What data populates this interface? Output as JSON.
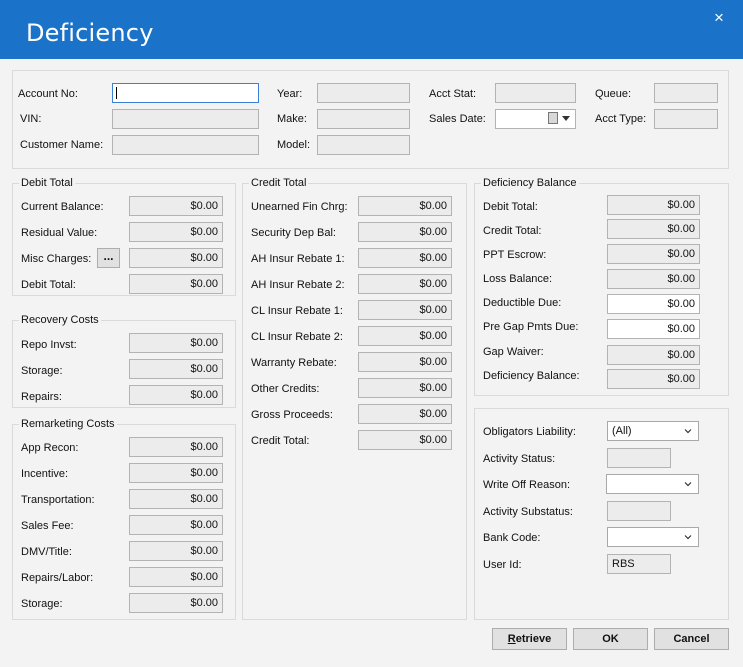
{
  "window": {
    "title": "Deficiency",
    "close_glyph": "×"
  },
  "header": {
    "account_no_label": "Account No:",
    "account_no_value": "",
    "vin_label": "VIN:",
    "customer_name_label": "Customer Name:",
    "year_label": "Year:",
    "make_label": "Make:",
    "model_label": "Model:",
    "acct_stat_label": "Acct Stat:",
    "sales_date_label": "Sales Date:",
    "queue_label": "Queue:",
    "acct_type_label": "Acct Type:"
  },
  "debit_total": {
    "title": "Debit Total",
    "rows": [
      {
        "label": "Current Balance:",
        "value": "$0.00"
      },
      {
        "label": "Residual Value:",
        "value": "$0.00"
      },
      {
        "label": "Misc Charges:",
        "value": "$0.00",
        "button": "..."
      },
      {
        "label": "Debit Total:",
        "value": "$0.00"
      }
    ]
  },
  "recovery_costs": {
    "title": "Recovery Costs",
    "rows": [
      {
        "label": "Repo Invst:",
        "value": "$0.00"
      },
      {
        "label": "Storage:",
        "value": "$0.00"
      },
      {
        "label": "Repairs:",
        "value": "$0.00"
      }
    ]
  },
  "remarketing_costs": {
    "title": "Remarketing Costs",
    "rows": [
      {
        "label": "App Recon:",
        "value": "$0.00"
      },
      {
        "label": "Incentive:",
        "value": "$0.00"
      },
      {
        "label": "Transportation:",
        "value": "$0.00"
      },
      {
        "label": "Sales Fee:",
        "value": "$0.00"
      },
      {
        "label": "DMV/Title:",
        "value": "$0.00"
      },
      {
        "label": "Repairs/Labor:",
        "value": "$0.00"
      },
      {
        "label": "Storage:",
        "value": "$0.00"
      }
    ]
  },
  "credit_total": {
    "title": "Credit Total",
    "rows": [
      {
        "label": "Unearned Fin Chrg:",
        "value": "$0.00"
      },
      {
        "label": "Security Dep Bal:",
        "value": "$0.00"
      },
      {
        "label": "AH Insur Rebate 1:",
        "value": "$0.00"
      },
      {
        "label": "AH Insur Rebate 2:",
        "value": "$0.00"
      },
      {
        "label": "CL Insur Rebate 1:",
        "value": "$0.00"
      },
      {
        "label": "CL Insur Rebate 2:",
        "value": "$0.00"
      },
      {
        "label": "Warranty Rebate:",
        "value": "$0.00"
      },
      {
        "label": "Other Credits:",
        "value": "$0.00"
      },
      {
        "label": "Gross Proceeds:",
        "value": "$0.00"
      },
      {
        "label": "Credit Total:",
        "value": "$0.00"
      }
    ]
  },
  "deficiency_balance": {
    "title": "Deficiency Balance",
    "rows": [
      {
        "label": "Debit Total:",
        "value": "$0.00"
      },
      {
        "label": "Credit Total:",
        "value": "$0.00"
      },
      {
        "label": "PPT Escrow:",
        "value": "$0.00"
      },
      {
        "label": "Loss Balance:",
        "value": "$0.00"
      },
      {
        "label": "Deductible Due:",
        "value": "$0.00"
      },
      {
        "label": "Pre Gap Pmts Due:",
        "value": "$0.00"
      },
      {
        "label": "Gap Waiver:",
        "value": "$0.00"
      },
      {
        "label": "Deficiency Balance:",
        "value": "$0.00"
      }
    ]
  },
  "status": {
    "obligators_liability_label": "Obligators Liability:",
    "obligators_liability_value": "(All)",
    "activity_status_label": "Activity Status:",
    "write_off_reason_label": "Write Off Reason:",
    "activity_substatus_label": "Activity Substatus:",
    "bank_code_label": "Bank Code:",
    "user_id_label": "User Id:",
    "user_id_value": "RBS"
  },
  "buttons": {
    "retrieve_first": "R",
    "retrieve_rest": "etrieve",
    "ok": "OK",
    "cancel": "Cancel"
  },
  "icons": {
    "close": "close-icon",
    "calendar": "calendar-icon",
    "dropdown": "chevron-down-icon"
  }
}
